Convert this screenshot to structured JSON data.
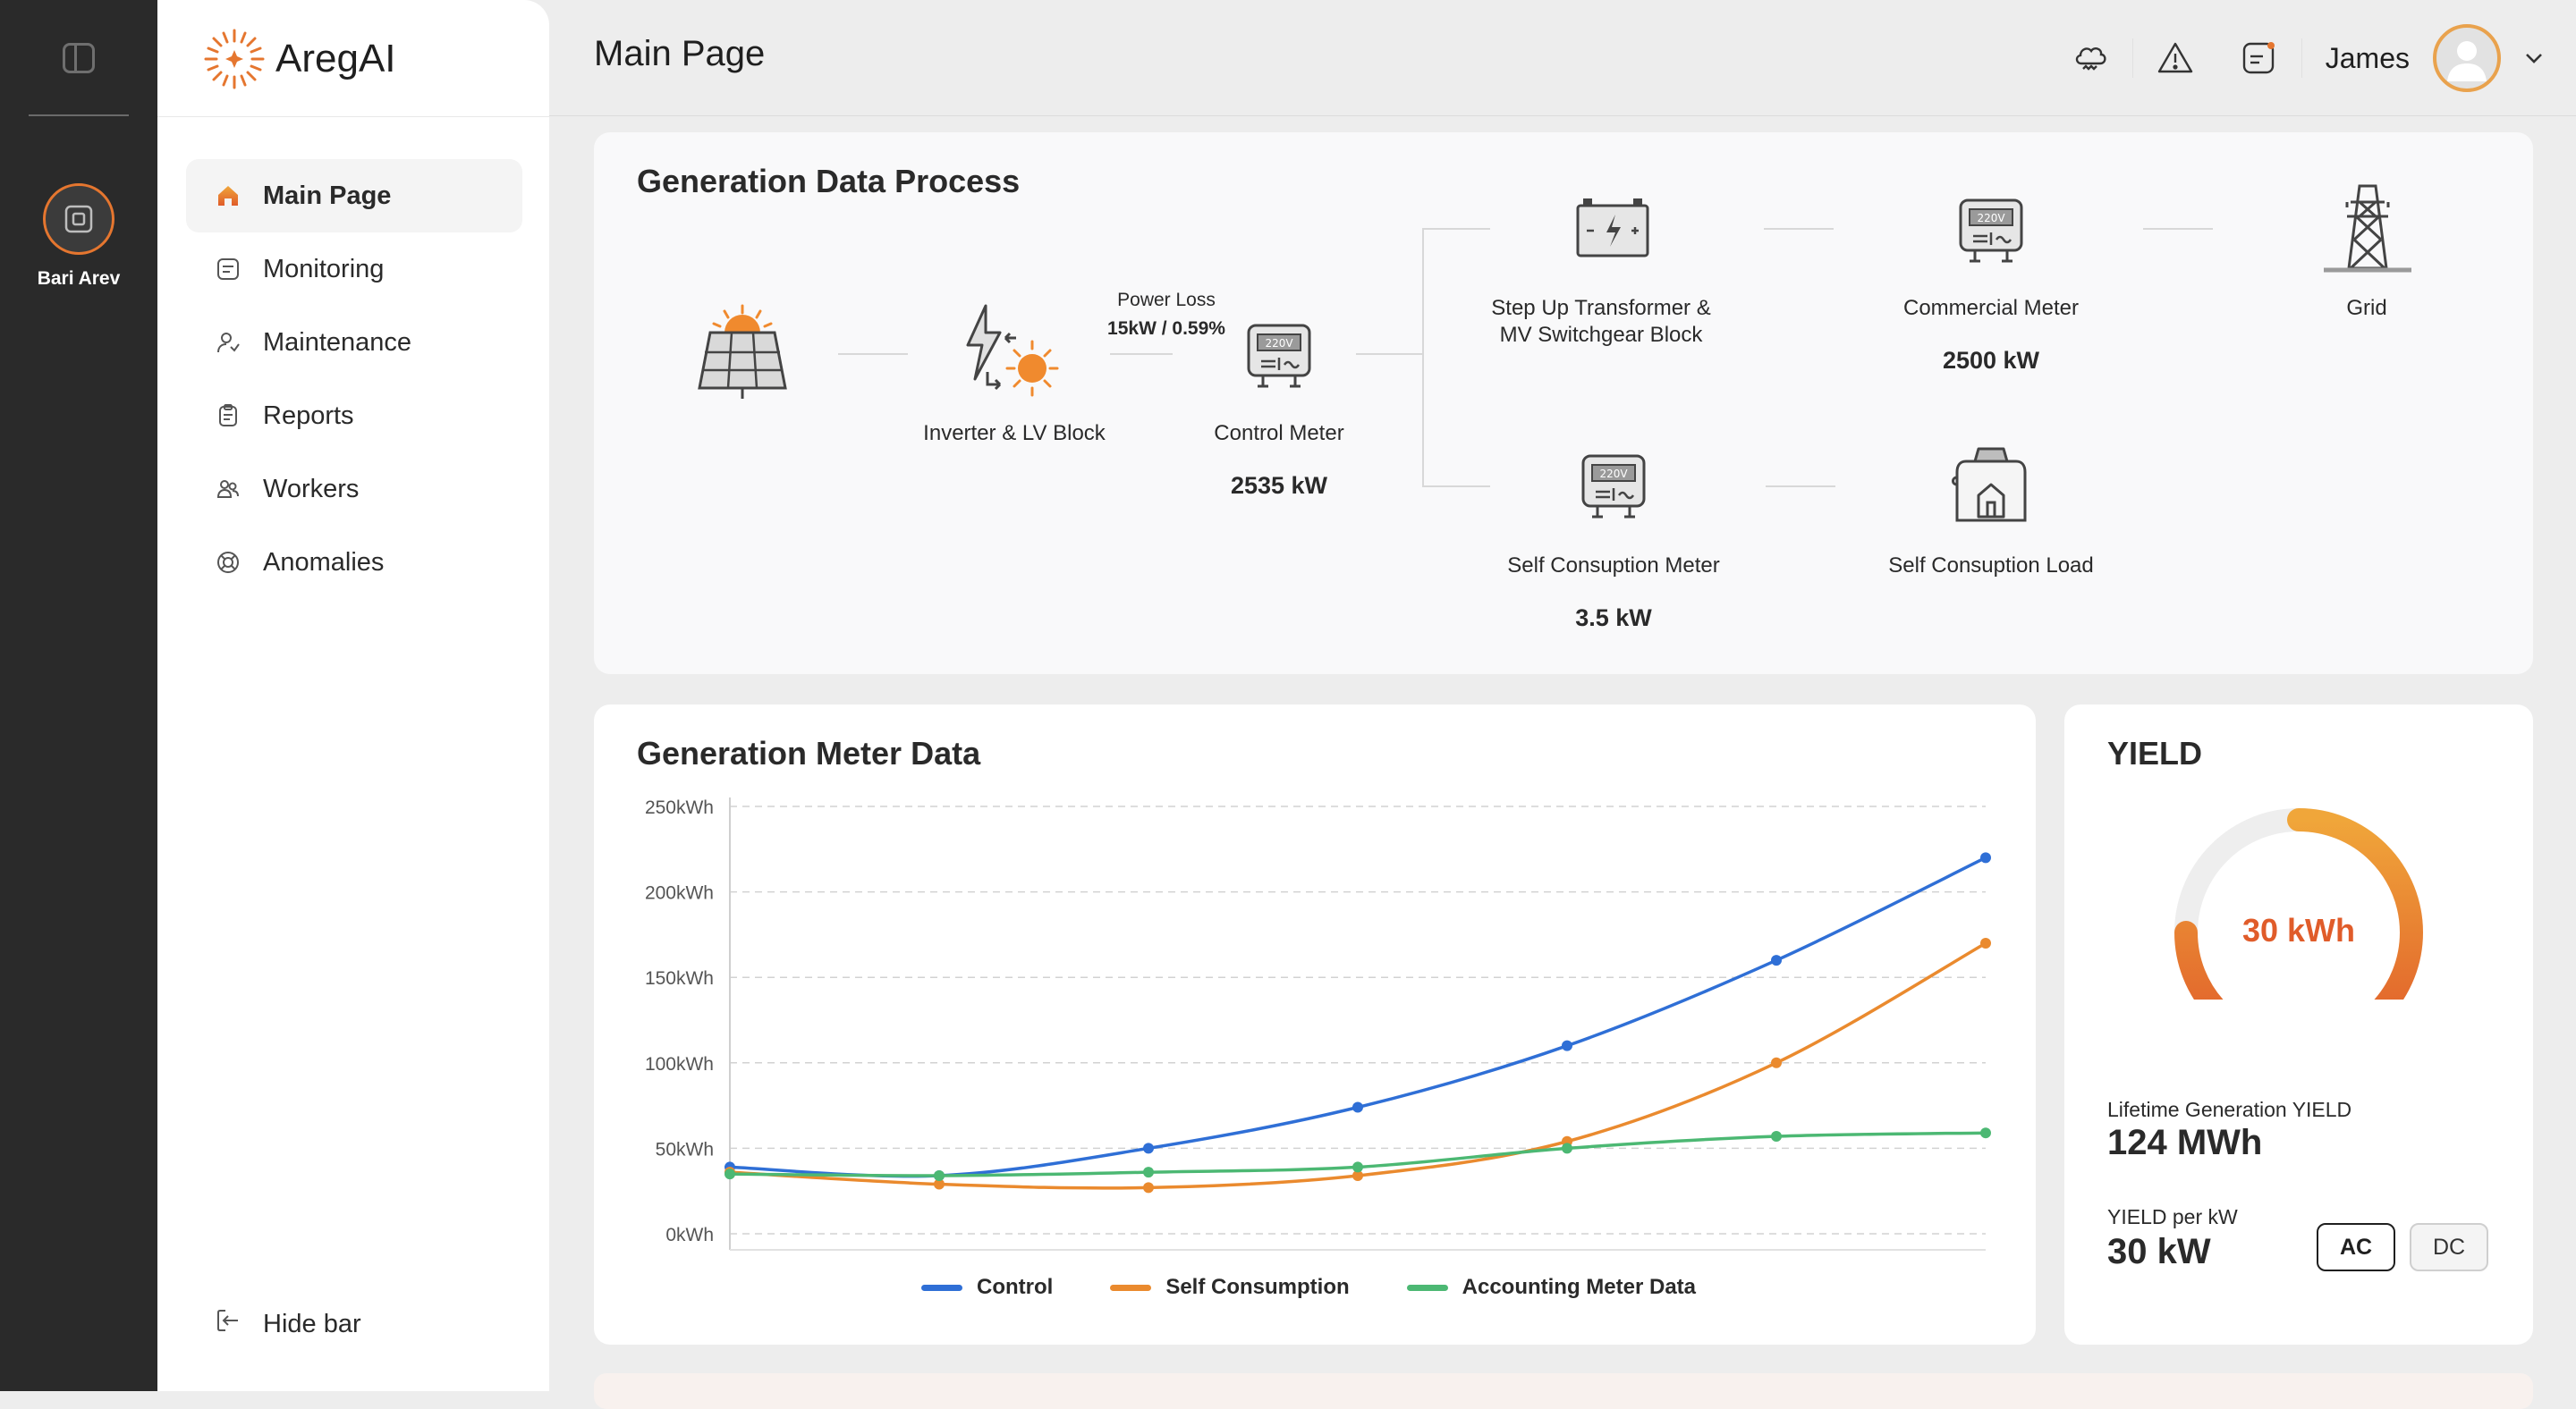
{
  "rail": {
    "workspace_name": "Bari Arev"
  },
  "brand": {
    "name": "AregAI",
    "accent": "#e5762f"
  },
  "sidebar": {
    "items": [
      {
        "label": "Main Page",
        "icon": "home-icon",
        "active": true
      },
      {
        "label": "Monitoring",
        "icon": "monitoring-icon",
        "active": false
      },
      {
        "label": "Maintenance",
        "icon": "maintenance-icon",
        "active": false
      },
      {
        "label": "Reports",
        "icon": "reports-icon",
        "active": false
      },
      {
        "label": "Workers",
        "icon": "workers-icon",
        "active": false
      },
      {
        "label": "Anomalies",
        "icon": "anomalies-icon",
        "active": false
      }
    ],
    "hide_bar_label": "Hide bar"
  },
  "header": {
    "title": "Main Page",
    "user_name": "James",
    "icons": [
      "weather-icon",
      "warning-icon",
      "notes-icon",
      "chevron-down-icon"
    ]
  },
  "process": {
    "title": "Generation Data Process",
    "inverter_label": "Inverter & LV Block",
    "power_loss_label": "Power Loss",
    "power_loss_value": "15kW / 0.59%",
    "control_meter_label": "Control Meter",
    "control_meter_value": "2535 kW",
    "transformer_label_1": "Step Up Transformer &",
    "transformer_label_2": "MV Switchgear Block",
    "commercial_meter_label": "Commercial Meter",
    "commercial_meter_value": "2500 kW",
    "grid_label": "Grid",
    "self_meter_label": "Self Consuption Meter",
    "self_meter_value": "3.5 kW",
    "self_load_label": "Self Consuption Load",
    "meter_display_text": "220V"
  },
  "chart_data": {
    "type": "line",
    "title": "Generation Meter Data",
    "x": [
      0,
      1,
      2,
      3,
      4,
      5,
      6
    ],
    "ylim": [
      0,
      250
    ],
    "y_ticks": [
      "250kWh",
      "200kWh",
      "150kWh",
      "100kWh",
      "50kWh",
      "0kWh"
    ],
    "grid": true,
    "legend_position": "bottom",
    "series": [
      {
        "name": "Control",
        "color": "#2f6fd6",
        "values": [
          39,
          34,
          50,
          74,
          110,
          160,
          220
        ]
      },
      {
        "name": "Self Consumption",
        "color": "#ea8a2e",
        "values": [
          36,
          29,
          27,
          34,
          54,
          100,
          170
        ]
      },
      {
        "name": "Accounting Meter Data",
        "color": "#4cb873",
        "values": [
          35,
          34,
          36,
          39,
          50,
          57,
          59
        ]
      }
    ]
  },
  "yield": {
    "title": "YIELD",
    "center_value": "30 kWh",
    "gauge_fraction": 0.75,
    "lifetime_label": "Lifetime Generation YIELD",
    "lifetime_value": "124 MWh",
    "per_kw_label": "YIELD per kW",
    "per_kw_value": "30 kW",
    "ac_label": "AC",
    "dc_label": "DC",
    "gradient_start": "#f0a63a",
    "gradient_end": "#e05c2a"
  }
}
